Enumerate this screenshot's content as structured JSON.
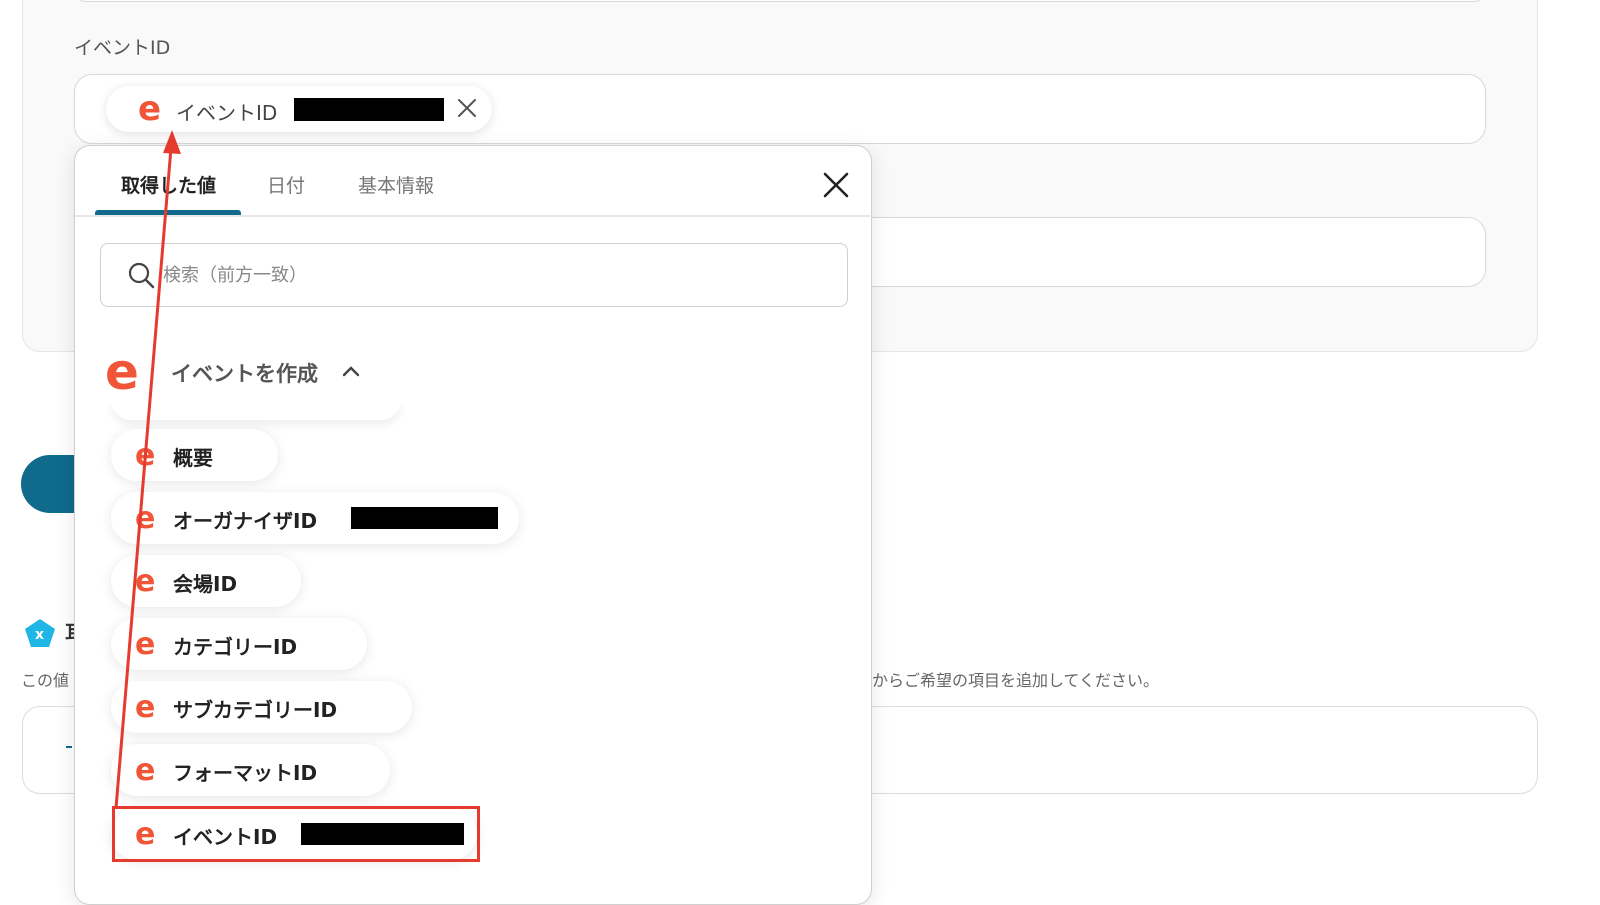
{
  "form": {
    "field_label": "イベントID",
    "chip_label": "イベントID"
  },
  "popup": {
    "tabs": [
      {
        "label": "取得した値",
        "active": true
      },
      {
        "label": "日付",
        "active": false
      },
      {
        "label": "基本情報",
        "active": false
      }
    ],
    "search_placeholder": "検索（前方一致）",
    "group_title": "イベントを作成",
    "items": [
      {
        "label": "概要"
      },
      {
        "label": "オーガナイザID"
      },
      {
        "label": "会場ID"
      },
      {
        "label": "カテゴリーID"
      },
      {
        "label": "サブカテゴリーID"
      },
      {
        "label": "フォーマットID"
      },
      {
        "label": "イベントID"
      }
    ]
  },
  "section": {
    "title_fragment": "耳",
    "help_fragment": "この値",
    "help_tail": "からご希望の項目を追加してください。"
  },
  "colors": {
    "brand_orange": "#f05537",
    "accent_blue": "#0f6a8c",
    "highlight_red": "#e53a2e"
  }
}
